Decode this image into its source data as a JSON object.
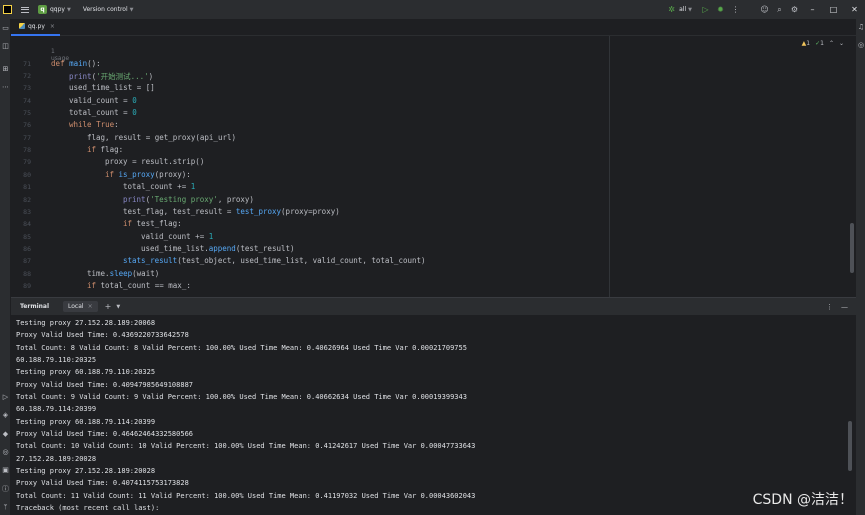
{
  "titlebar": {
    "project_badge": "q",
    "project_name": "qqpy",
    "vcs_label": "Version control",
    "run_config": "all"
  },
  "tabs": [
    {
      "label": "qq.py"
    }
  ],
  "editor": {
    "inspection": {
      "warnings": "1",
      "ok": "1"
    },
    "usage_hint": "1 usage",
    "line_numbers": [
      "71",
      "72",
      "73",
      "74",
      "75",
      "76",
      "77",
      "78",
      "79",
      "80",
      "81",
      "82",
      "83",
      "84",
      "85",
      "86",
      "87",
      "88",
      "89"
    ]
  },
  "terminal": {
    "title": "Terminal",
    "tab_label": "Local",
    "lines": [
      "Testing proxy 27.152.28.189:20068",
      "Proxy Valid Used Time: 0.4369220733642578",
      "Total Count: 8 Valid Count: 8 Valid Percent: 100.00% Used Time Mean: 0.40626964 Used Time Var 0.00021709755",
      "60.188.79.110:20325",
      "Testing proxy 60.188.79.110:20325",
      "Proxy Valid Used Time: 0.40947985649108887",
      "Total Count: 9 Valid Count: 9 Valid Percent: 100.00% Used Time Mean: 0.40662634 Used Time Var 0.00019399343",
      "60.188.79.114:20399",
      "Testing proxy 60.188.79.114:20399",
      "Proxy Valid Used Time: 0.46462464332580566",
      "Total Count: 10 Valid Count: 10 Valid Percent: 100.00% Used Time Mean: 0.41242617 Used Time Var 0.00047733643",
      "27.152.28.189:20028",
      "Testing proxy 27.152.28.189:20028",
      "Proxy Valid Used Time: 0.4074115753173828",
      "Total Count: 11 Valid Count: 11 Valid Percent: 100.00% Used Time Mean: 0.41197032 Used Time Var 0.00043602043",
      "Traceback (most recent call last):"
    ]
  },
  "watermark": "CSDN @洁洁！"
}
